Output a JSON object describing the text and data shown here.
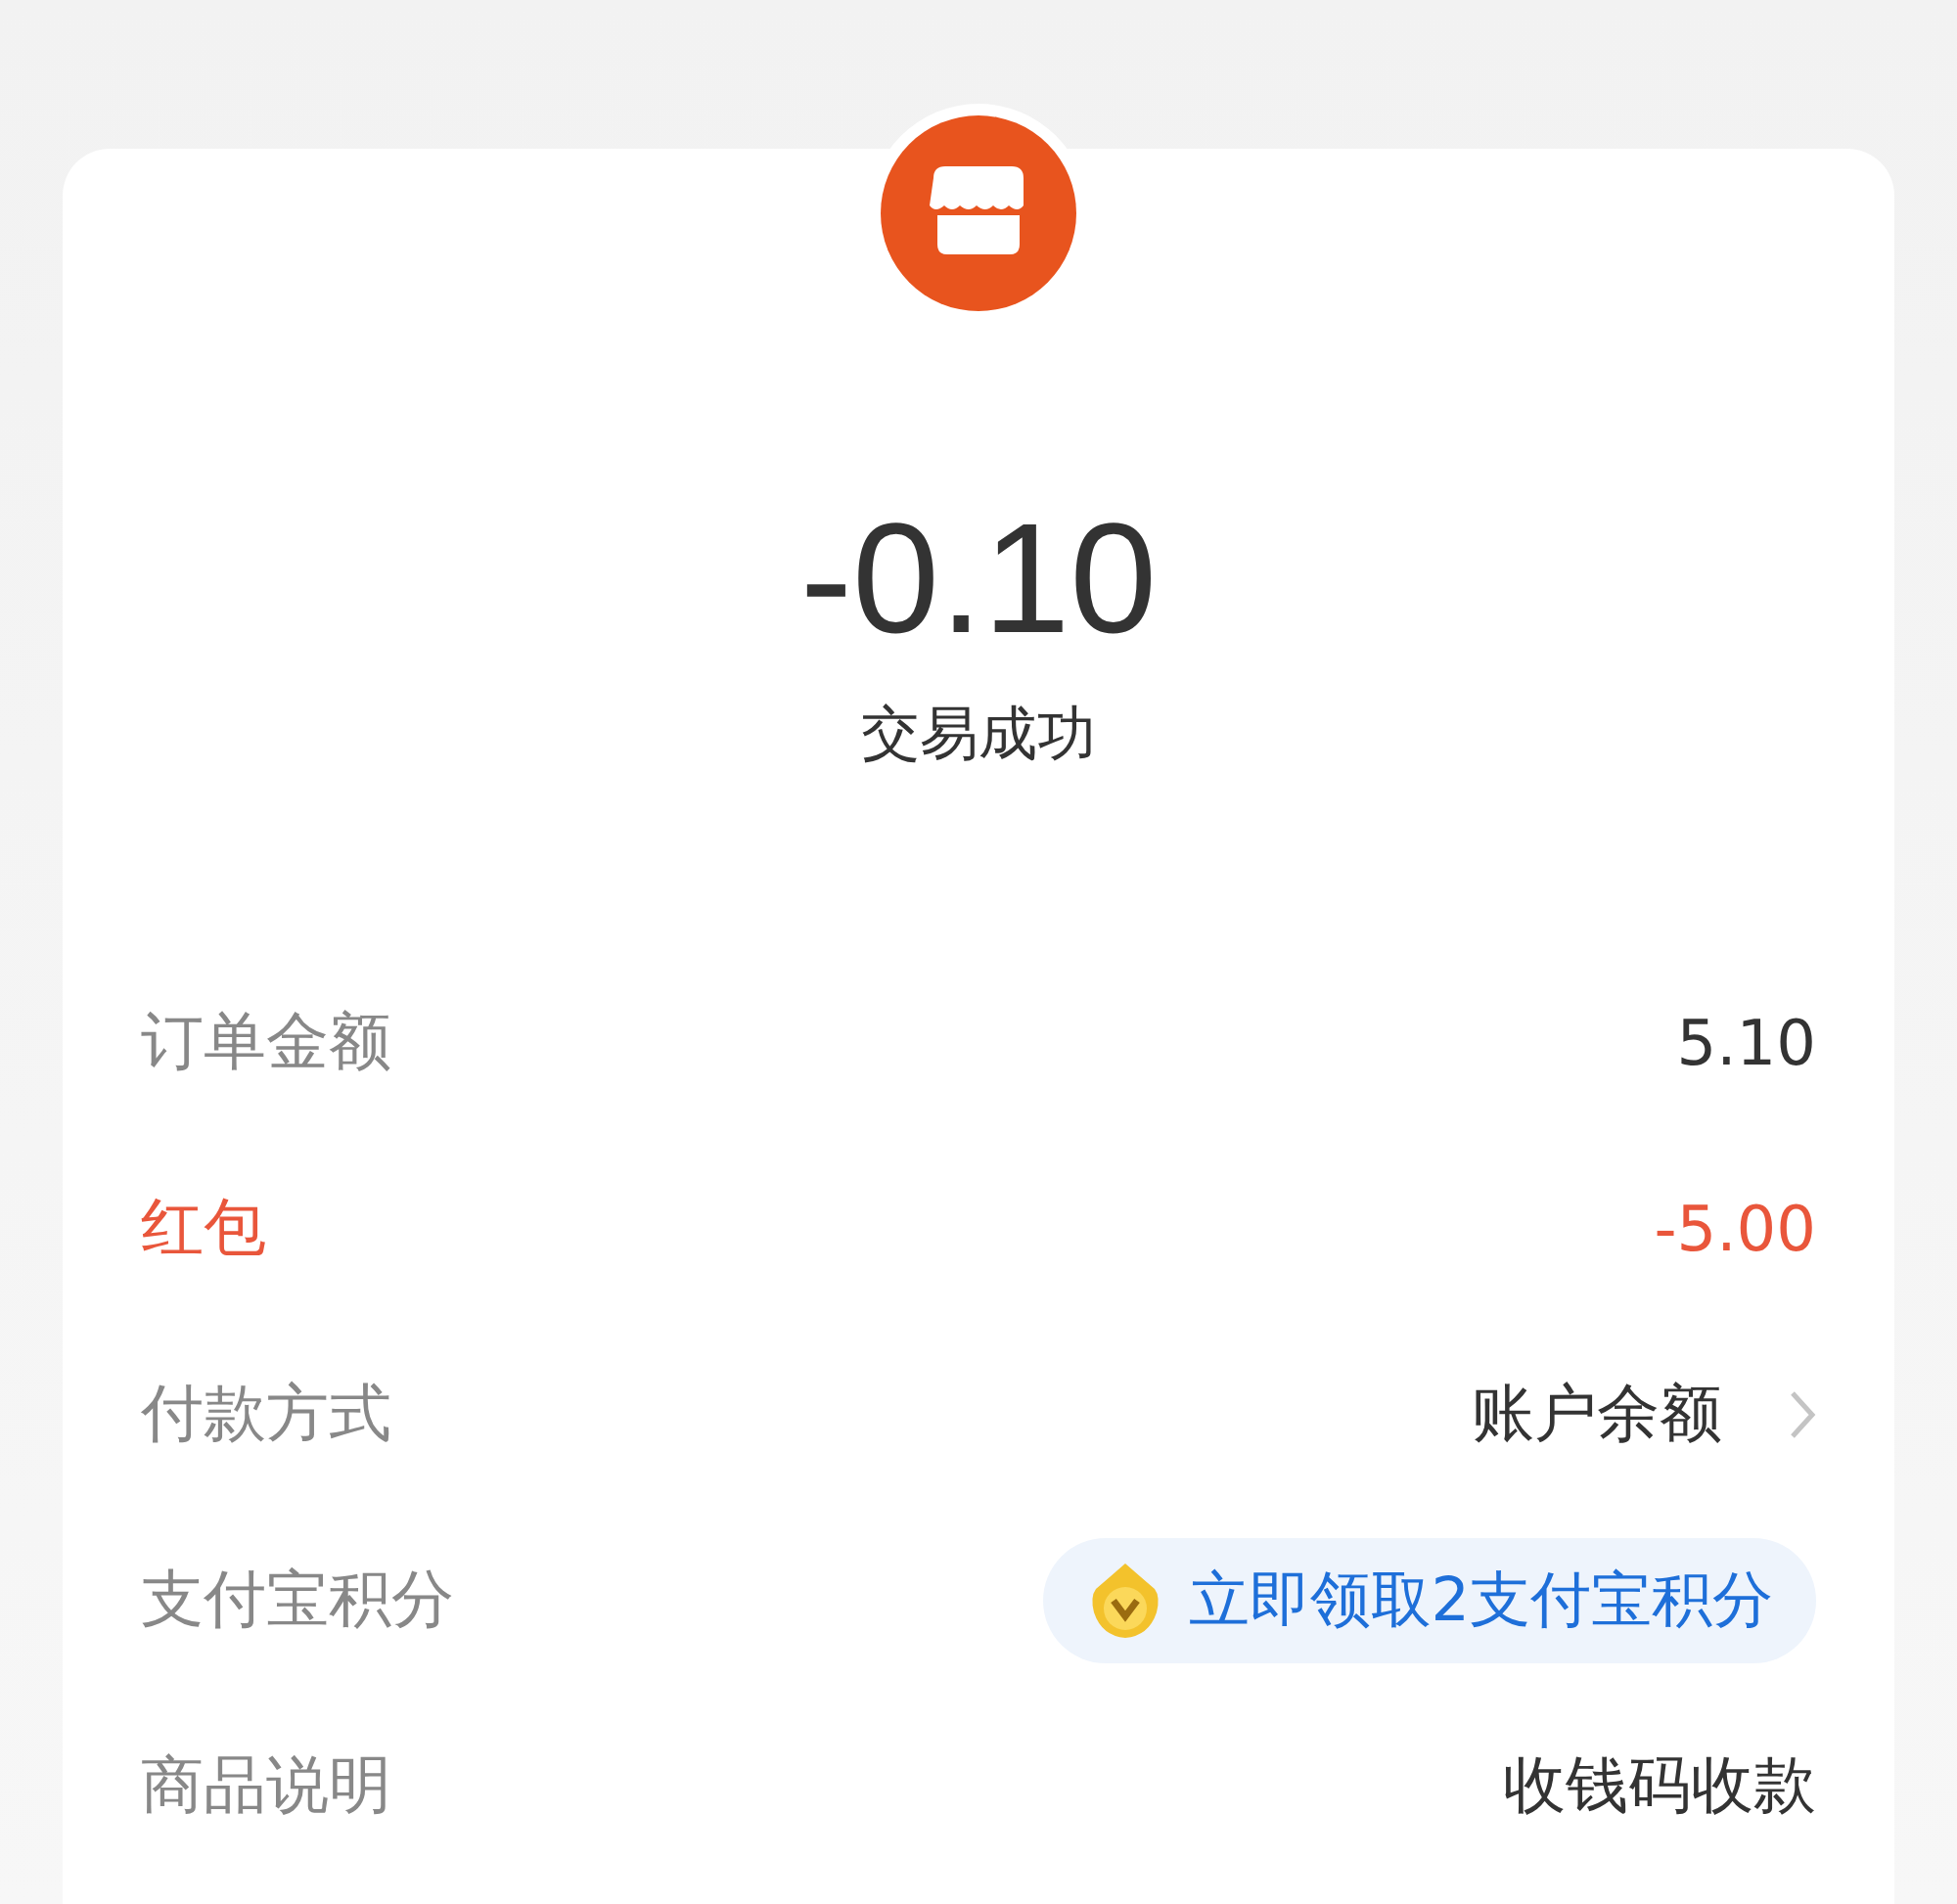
{
  "amount": "-0.10",
  "status": "交易成功",
  "rows": [
    {
      "kind": "text",
      "label": "订单金额",
      "value": "5.10"
    },
    {
      "kind": "discount",
      "label": "红包",
      "value": "-5.00"
    },
    {
      "kind": "link",
      "label": "付款方式",
      "value": "账户余额"
    },
    {
      "kind": "badge",
      "label": "支付宝积分",
      "value": "立即领取2支付宝积分"
    },
    {
      "kind": "text",
      "label": "商品说明",
      "value": "收钱码收款"
    }
  ]
}
